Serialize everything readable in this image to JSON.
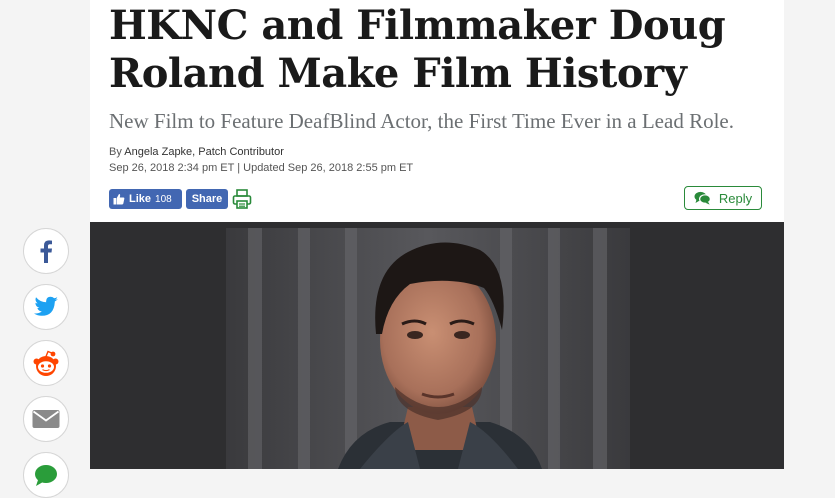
{
  "article": {
    "headline": "HKNC and Filmmaker Doug Roland Make Film History",
    "subhead": "New Film to Feature DeafBlind Actor, the First Time Ever in a Lead Role.",
    "byline_prefix": "By",
    "author": "Angela Zapke, Patch Contributor",
    "dates": "Sep 26, 2018 2:34 pm ET | Updated Sep 26, 2018 2:55 pm ET"
  },
  "actions": {
    "like_label": "Like",
    "like_count": "108",
    "share_label": "Share",
    "print_icon": "printer-icon",
    "reply_label": "Reply",
    "reply_icon": "comment-bubbles-icon"
  },
  "share_rail": [
    {
      "icon": "facebook-icon",
      "color": "#3b5998"
    },
    {
      "icon": "twitter-icon",
      "color": "#1da1f2"
    },
    {
      "icon": "reddit-icon",
      "color": "#ff4500"
    },
    {
      "icon": "email-icon",
      "color": "#8a8a8a"
    },
    {
      "icon": "message-icon",
      "color": "#2a9d3a"
    }
  ],
  "colors": {
    "facebook_blue": "#4267b2",
    "reply_green": "#2a8a3a",
    "headline": "#1a1a1a",
    "subhead": "#6b6f72"
  }
}
